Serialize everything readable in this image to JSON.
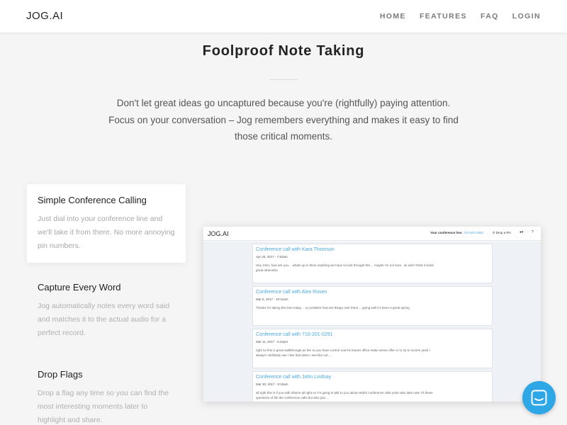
{
  "header": {
    "logo": "JOG.AI",
    "nav": [
      "HOME",
      "FEATURES",
      "FAQ",
      "LOGIN"
    ]
  },
  "section": {
    "title": "Foolproof Note Taking",
    "intro": "Don't let great ideas go uncaptured because you're (rightfully) paying attention. Focus on your conversation – Jog remembers everything and makes it easy to find those critical moments."
  },
  "features": [
    {
      "title": "Simple Conference Calling",
      "text": "Just dial into your conference line and we'll take it from there. No more annoying pin numbers."
    },
    {
      "title": "Capture Every Word",
      "text": "Jog automatically notes every word said and matches it to the actual audio for a perfect record."
    },
    {
      "title": "Drop Flags",
      "text": "Drop a flag any time so you can find the most interesting moments later to highlight and share."
    }
  ],
  "mockup": {
    "logo": "JOG.AI",
    "conference_label": "Your conference line:",
    "conference_number": "710-401-2552",
    "drop_pin": "Drop a Pin",
    "user_menu": "▾",
    "help": "?",
    "calls": [
      {
        "title": "Conference call with Kara Thomson",
        "date": "Apr 26, 2017 - 7:52am",
        "snippet": "Hey John, how are you… whats up is there anything we have to look through this… maybe i'm not sure.. ok well I think it looks great otherwise"
      },
      {
        "title": "Conference call with Alex Rosen",
        "date": "Mar 5, 2017 - 10:41am",
        "snippet": "Thanks for taking the time today… no problem how are things over there… going well it's been a great spring"
      },
      {
        "title": "Conference call with 710-201-0291",
        "date": "Mar 11, 2017 - 5:22pm",
        "snippet": "right so this is great walkthrough as the so you have control now he leaves office make sense offer or to try to screen yeah I always I definitely see I like that when I see like not…."
      },
      {
        "title": "Conference call with John Lindsay",
        "date": "Mar 30, 2017 - 9:15am",
        "snippet": "all right this is if you with shame all right so I'm going to talk to you about Haiti's conference calls yeah also take note 70 these questions of life the conference calls but also just…."
      }
    ]
  },
  "colors": {
    "accent": "#2ea7e7",
    "link": "#4aa8e0"
  },
  "chat": {
    "icon": "chat-icon"
  }
}
